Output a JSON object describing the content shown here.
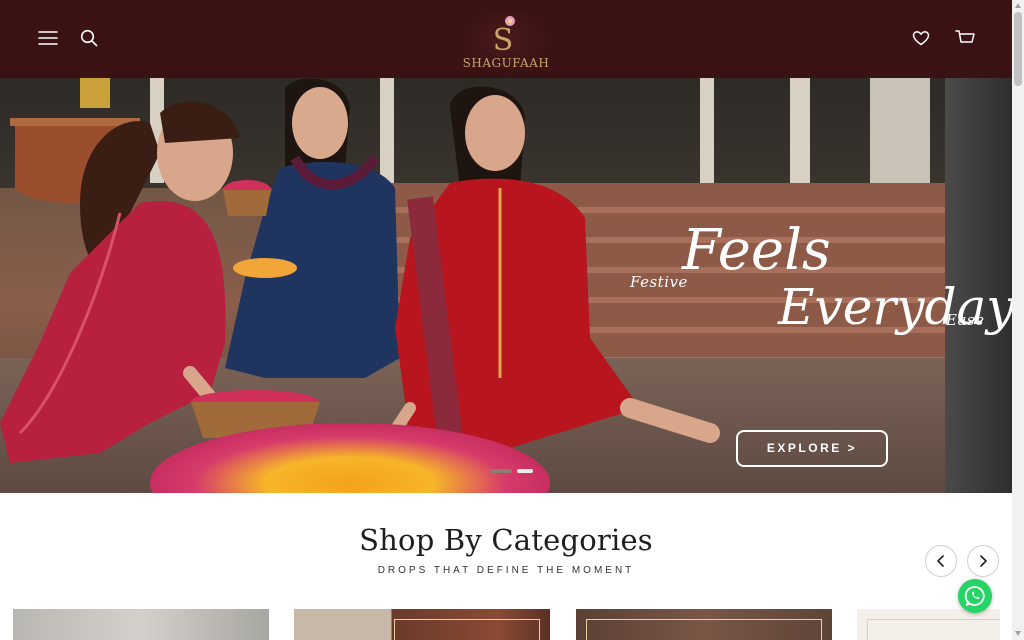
{
  "header": {
    "brand_name": "SHAGUFAAH",
    "logo_letter": "S",
    "icons": [
      "menu-icon",
      "search-icon",
      "heart-icon",
      "cart-icon"
    ]
  },
  "hero": {
    "tagline_left": "Festive",
    "tagline_big_1": "Feels",
    "tagline_big_2": "Everyday",
    "tagline_right": "Ease",
    "cta_label": "EXPLORE >"
  },
  "categories": {
    "title": "Shop By Categories",
    "subtitle": "DROPS THAT DEFINE THE MOMENT"
  },
  "colors": {
    "header_bg": "#3a1214",
    "brand_gold": "#c9a36a",
    "whatsapp_green": "#25d366"
  }
}
